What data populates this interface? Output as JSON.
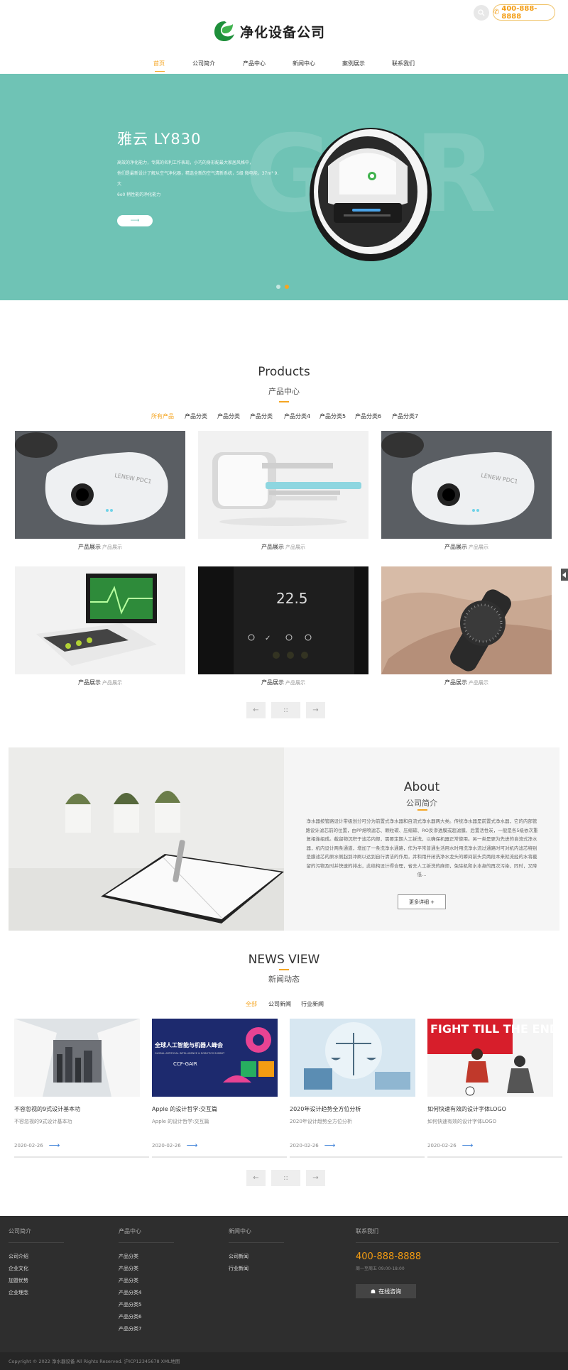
{
  "header": {
    "logo_text": "净化设备公司",
    "phone": "400-888-8888",
    "nav": [
      "首页",
      "公司简介",
      "产品中心",
      "新闻中心",
      "案例展示",
      "联系我们"
    ]
  },
  "banner": {
    "bg_text": "GQR",
    "title": "雅云 LY830",
    "desc_lines": [
      "高效的净化能力，专属的名利工作表现，小巧的身形配最大家居风格中，",
      "他们是最新设计了解从空气净化器，精选全新的空气清新系统，5级 微电能，37m³ 9.大",
      "6o0 稍性能的净化能力"
    ],
    "button": "⟶",
    "slide_count": 2,
    "active_slide": 2
  },
  "products": {
    "title": "Products",
    "subtitle": "产品中心",
    "tabs": [
      "所有产品",
      "产品分类",
      "产品分类",
      "产品分类",
      "产品分类4",
      "产品分类5",
      "产品分类6",
      "产品分类7"
    ],
    "items": [
      {
        "name": "产品展示",
        "cat": "产品展示",
        "img": "device-gray"
      },
      {
        "name": "产品展示",
        "cat": "产品展示",
        "img": "machine-white"
      },
      {
        "name": "产品展示",
        "cat": "产品展示",
        "img": "device-gray"
      },
      {
        "name": "产品展示",
        "cat": "产品展示",
        "img": "monitor-green"
      },
      {
        "name": "产品展示",
        "cat": "产品展示",
        "img": "thermostat"
      },
      {
        "name": "产品展示",
        "cat": "产品展示",
        "img": "watch"
      }
    ],
    "device_label": "LENEW PDC1",
    "thermo_value": "22.5"
  },
  "pager": {
    "prev": "←",
    "mid": "::",
    "next": "→"
  },
  "about": {
    "title": "About",
    "subtitle": "公司简介",
    "text": "净水器按管路设计带级划分可分为前置式净水器和自流式净水器两大类。传统净水器是前置式净水器，它的内部管路设计滤芯前的位置，由PP熔喷滤芯、颗粒碳、压缩碳、RO反渗透膜或超滤膜、后置活性炭，一般是各5级依次重复相连组成。截留物沉积于滤芯内部，需要定期人工拆洗，以确保机器正常使用。另一类是更为先进的自流式净水器，机内设计两条通道，增加了一条洗净水通路，作为平常普通生活用水时用洗净水流过通路时可对机内滤芯特别是膜滤芯的原水侧起到冲刷以达到自行清洁的作用，并和用开闭洗净水龙头的瞬间前头荧两段本来就流经的水将截留的污物及时并快速的排出，此结构设计得合理，省去人工拆洗的麻烦，免除机和水本身的再次污染，同时，又降低...",
    "more": "更多详细 +"
  },
  "news": {
    "title": "NEWS VIEW",
    "subtitle": "新闻动态",
    "tabs": [
      "全部",
      "公司新闻",
      "行业新闻"
    ],
    "items": [
      {
        "title": "不容忽视的9式设计基本功",
        "summary": "不容忽视的9式设计基本功",
        "date": "2020-02-26"
      },
      {
        "title": "Apple 的设计哲学:交互篇",
        "summary": "Apple 的设计哲学:交互篇",
        "date": "2020-02-26"
      },
      {
        "title": "2020年设计趋势全方位分析",
        "summary": "2020年设计趋势全方位分析",
        "date": "2020-02-26"
      },
      {
        "title": "如何快速有效的设计字体LOGO",
        "summary": "如何快速有效的设计字体LOGO",
        "date": "2020-02-26"
      }
    ],
    "img2_title": "全球人工智能与机器人峰会",
    "img2_sub": "GLOBAL ARTIFICIAL INTELLIGENCE & ROBOTICS SUMMIT",
    "img2_brand": "CCF-GAIR",
    "img4_text": "FIGHT TILL THE END"
  },
  "footer": {
    "cols": [
      {
        "head": "公司简介",
        "links": [
          "公司介绍",
          "企业文化",
          "加盟优势",
          "企业理念"
        ]
      },
      {
        "head": "产品中心",
        "links": [
          "产品分类",
          "产品分类",
          "产品分类",
          "产品分类4",
          "产品分类5",
          "产品分类6",
          "产品分类7"
        ]
      },
      {
        "head": "新闻中心",
        "links": [
          "公司新闻",
          "行业新闻"
        ]
      }
    ],
    "contact_head": "联系我们",
    "phone": "400-888-8888",
    "hours": "周一至周五 09:00-18:00",
    "consult": "在线咨询",
    "copyright": "Copyright © 2022 净水器设备 All Rights Reserved. 沪ICP12345678 XML地图"
  },
  "colors": {
    "accent": "#f5a623",
    "banner": "#6fc3b5",
    "footer": "#2e2e2e",
    "link": "#3a7fd8"
  }
}
